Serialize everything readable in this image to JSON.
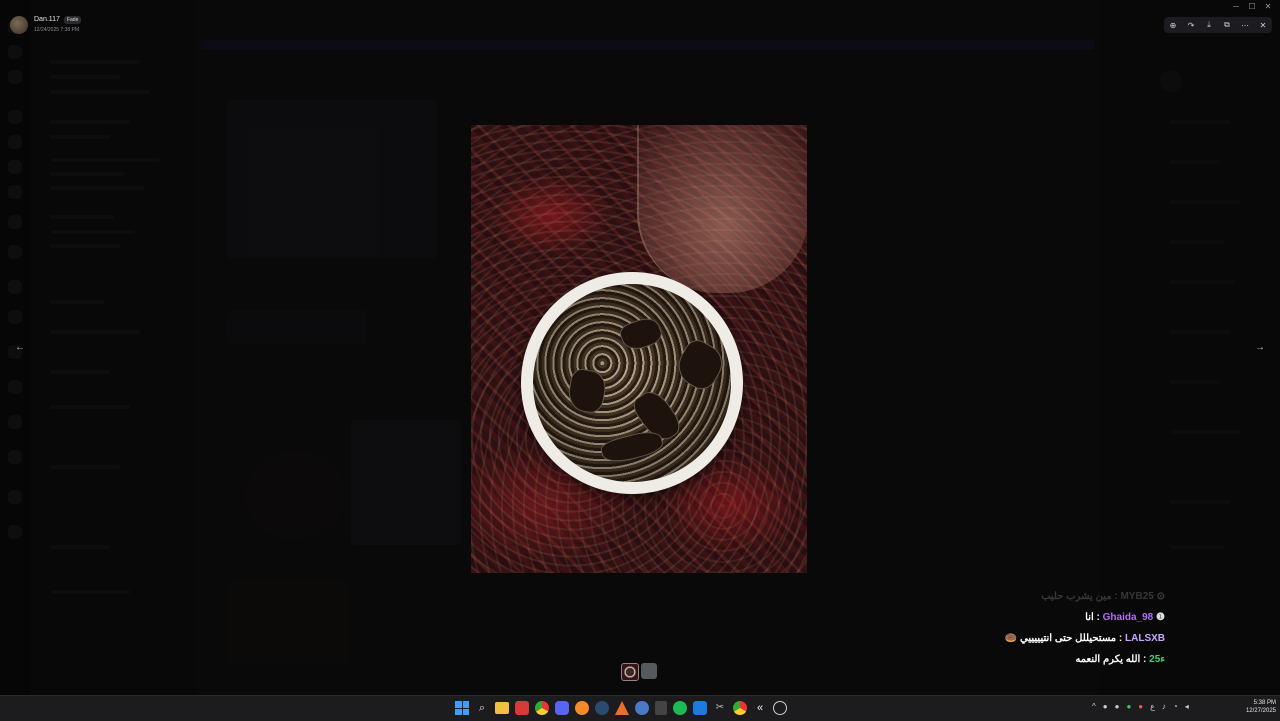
{
  "author": {
    "name": "Dan.117",
    "tag": "Fade",
    "date": "12/24/2025 7:38 PM"
  },
  "window_controls": [
    "─",
    "☐",
    "✕"
  ],
  "toolbar": {
    "zoom_icon": "⊕",
    "forward_icon": "↷",
    "download_icon": "⤓",
    "open_icon": "⧉",
    "more_icon": "⋯",
    "close_icon": "✕"
  },
  "nav": {
    "prev": "←",
    "next": "→"
  },
  "chat_overlay": {
    "lines": [
      {
        "user": "MYB25",
        "text": "مين يشرب حليب",
        "user_color": "#bfbfbf",
        "badge": "⊙"
      },
      {
        "user": "Ghaida_98",
        "text": "انا",
        "user_color": "#b36bff",
        "badge": "❶"
      },
      {
        "user": "LALSXB",
        "text": "مستحيللل حتى انتيييييي",
        "user_color": "#c9a6ff",
        "badge": "🍩"
      },
      {
        "user": "ء25",
        "text": "الله يكرم النعمه",
        "user_color": "#3fd07a",
        "badge": ""
      }
    ]
  },
  "taskbar": {
    "icons": [
      "windows-start",
      "search",
      "file-explorer",
      "red-app",
      "chrome",
      "discord",
      "browser-orange",
      "steam",
      "vlc-like",
      "blue-app",
      "calculator",
      "spotify",
      "app-store",
      "snipping-tool",
      "chrome-2",
      "capcut",
      "chatgpt"
    ],
    "tray": [
      "^",
      "discord",
      "steam",
      "green",
      "red-circle",
      "ع",
      "mic",
      "wifi",
      "volume"
    ],
    "time": "5:38 PM",
    "date": "12/27/2025"
  }
}
